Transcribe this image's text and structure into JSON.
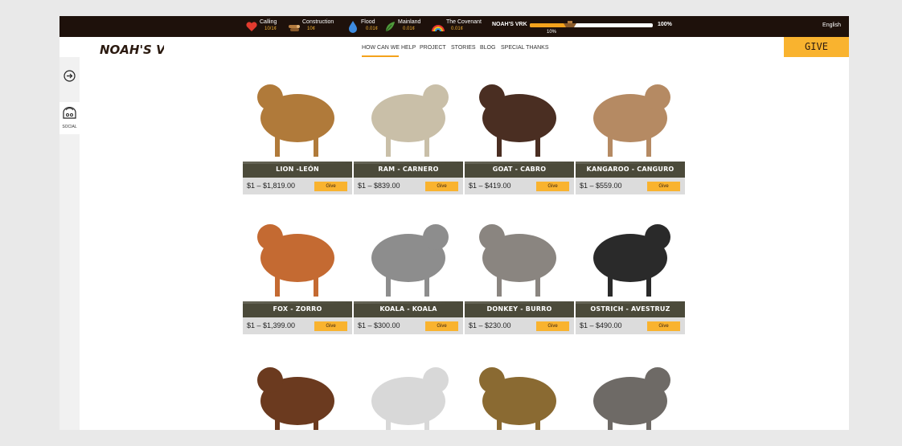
{
  "topbar": {
    "stats": [
      {
        "icon": "heart-icon",
        "label": "Calling",
        "value": "10/1¢"
      },
      {
        "icon": "wood-logs-icon",
        "label": "Construction",
        "value": "10¢"
      },
      {
        "icon": "water-drop-icon",
        "label": "Flood",
        "value": "0.01¢"
      },
      {
        "icon": "leaf-icon",
        "label": "Mainland",
        "value": "0.01¢"
      },
      {
        "icon": "rainbow-icon",
        "label": "The Covenant",
        "value": "0.01¢"
      }
    ],
    "progress_label": "NOAH'S VRK",
    "progress_fraction": 0.33,
    "progress_start": "10%",
    "progress_end": "100%",
    "language": "English"
  },
  "header": {
    "logo_text": "NOAH'S VRK",
    "nav": [
      "HOW CAN WE HELP",
      "PROJECT",
      "STORIES",
      "BLOG",
      "SPECIAL THANKS"
    ],
    "active_nav": "HOW CAN WE HELP",
    "give_label": "GIVE"
  },
  "rail": {
    "social_label": "SOCIAL"
  },
  "animals": [
    {
      "name": "LION -LEÓN",
      "price": "$1 – $1,819.00",
      "give": "Give",
      "color": "#b07a3a"
    },
    {
      "name": "RAM - CARNERO",
      "price": "$1 – $839.00",
      "give": "Give",
      "color": "#c9bfa8"
    },
    {
      "name": "GOAT - CABRO",
      "price": "$1 – $419.00",
      "give": "Give",
      "color": "#4a2e22"
    },
    {
      "name": "KANGAROO - CANGURO",
      "price": "$1 – $559.00",
      "give": "Give",
      "color": "#b58a63"
    },
    {
      "name": "FOX - ZORRO",
      "price": "$1 – $1,399.00",
      "give": "Give",
      "color": "#c46a32"
    },
    {
      "name": "KOALA - KOALA",
      "price": "$1 – $300.00",
      "give": "Give",
      "color": "#8d8d8d"
    },
    {
      "name": "DONKEY - BURRO",
      "price": "$1 – $230.00",
      "give": "Give",
      "color": "#8a8580"
    },
    {
      "name": "OSTRICH - AVESTRUZ",
      "price": "$1 – $490.00",
      "give": "Give",
      "color": "#2a2a2a"
    },
    {
      "name": "",
      "price": "",
      "give": "",
      "color": "#6b3a1f"
    },
    {
      "name": "",
      "price": "",
      "give": "",
      "color": "#d8d8d8"
    },
    {
      "name": "",
      "price": "",
      "give": "",
      "color": "#8a6a32"
    },
    {
      "name": "",
      "price": "",
      "give": "",
      "color": "#6e6a66"
    }
  ]
}
